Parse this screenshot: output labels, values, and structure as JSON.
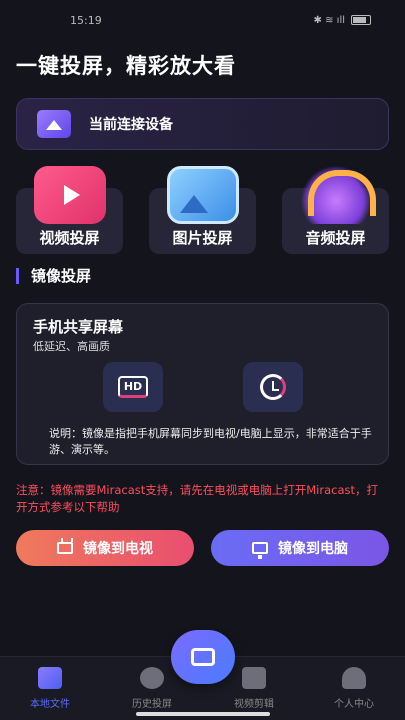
{
  "status_bar": {
    "time": "15:19",
    "icons": "✱ ≋ ıll"
  },
  "headline": "一键投屏，精彩放大看",
  "device_card": {
    "label": "当前连接设备",
    "icon": "cast-icon"
  },
  "features": [
    {
      "label": "视频投屏",
      "icon": "video-play-icon"
    },
    {
      "label": "图片投屏",
      "icon": "image-icon"
    },
    {
      "label": "音频投屏",
      "icon": "headphones-icon"
    }
  ],
  "section_title": "镜像投屏",
  "mirror_card": {
    "title": "手机共享屏幕",
    "subtitle": "低延迟、高画质",
    "hd_text": "HD",
    "description": "说明：镜像是指把手机屏幕同步到电视/电脑上显示，非常适合于手游、演示等。"
  },
  "notice": "注意：镜像需要Miracast支持，请先在电视或电脑上打开Miracast，打开方式参考以下帮助",
  "buttons": {
    "tv": "镜像到电视",
    "pc": "镜像到电脑"
  },
  "tabs": [
    {
      "label": "本地文件",
      "active": true
    },
    {
      "label": "历史投屏",
      "active": false
    },
    {
      "label": "视频剪辑",
      "active": false
    },
    {
      "label": "个人中心",
      "active": false
    }
  ],
  "colors": {
    "accent": "#5a6cff",
    "warning": "#ff4d5e",
    "background": "#14141c"
  }
}
